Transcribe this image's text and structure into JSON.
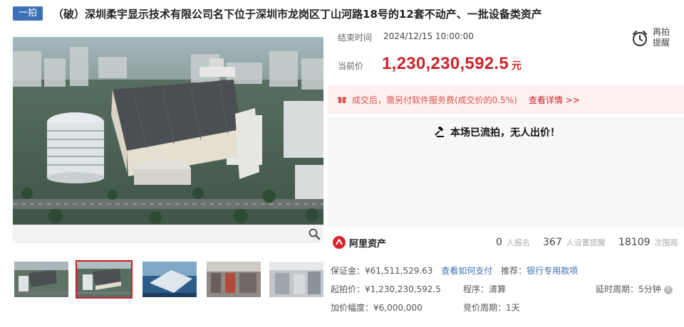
{
  "header": {
    "round_badge": "一拍",
    "title": "（破）深圳柔宇显示技术有限公司名下位于深圳市龙岗区丁山河路18号的12套不动产、一批设备类资产"
  },
  "auction": {
    "end_label": "结束时间",
    "end_time": "2024/12/15 10:00:00",
    "remind_line1": "再拍",
    "remind_line2": "提醒",
    "price_label": "当前价",
    "price_value": "1,230,230,592.5",
    "price_unit": "元",
    "fee_text": "成交后，需另付软件服务费(成交价的0.5%)",
    "fee_link": "查看详情 >>",
    "status_text": "本场已流拍，无人出价！"
  },
  "stats": {
    "brand": "阿里资产",
    "signups_num": "0",
    "signups_label": "人报名",
    "reminders_num": "367",
    "reminders_label": "人设置提醒",
    "views_num": "18109",
    "views_label": "次围观"
  },
  "details": {
    "deposit": "保证金：¥61,511,529.63",
    "deposit_link": "查看如何支付",
    "recommend_label": "推荐：",
    "recommend_link": "银行专用款项",
    "start_price": "起拍价：¥1,230,230,592.5",
    "procedure": "程序：清算",
    "delay": "延时周期：5分钟",
    "increment": "加价幅度：¥6,000,000",
    "bid_cycle": "竞价周期：1天"
  },
  "colors": {
    "accent_red": "#c9252c",
    "badge_blue": "#3d6fb5",
    "fee_bg": "#fdf0f0"
  },
  "thumbnails": {
    "count": 5,
    "active_index": 1
  }
}
